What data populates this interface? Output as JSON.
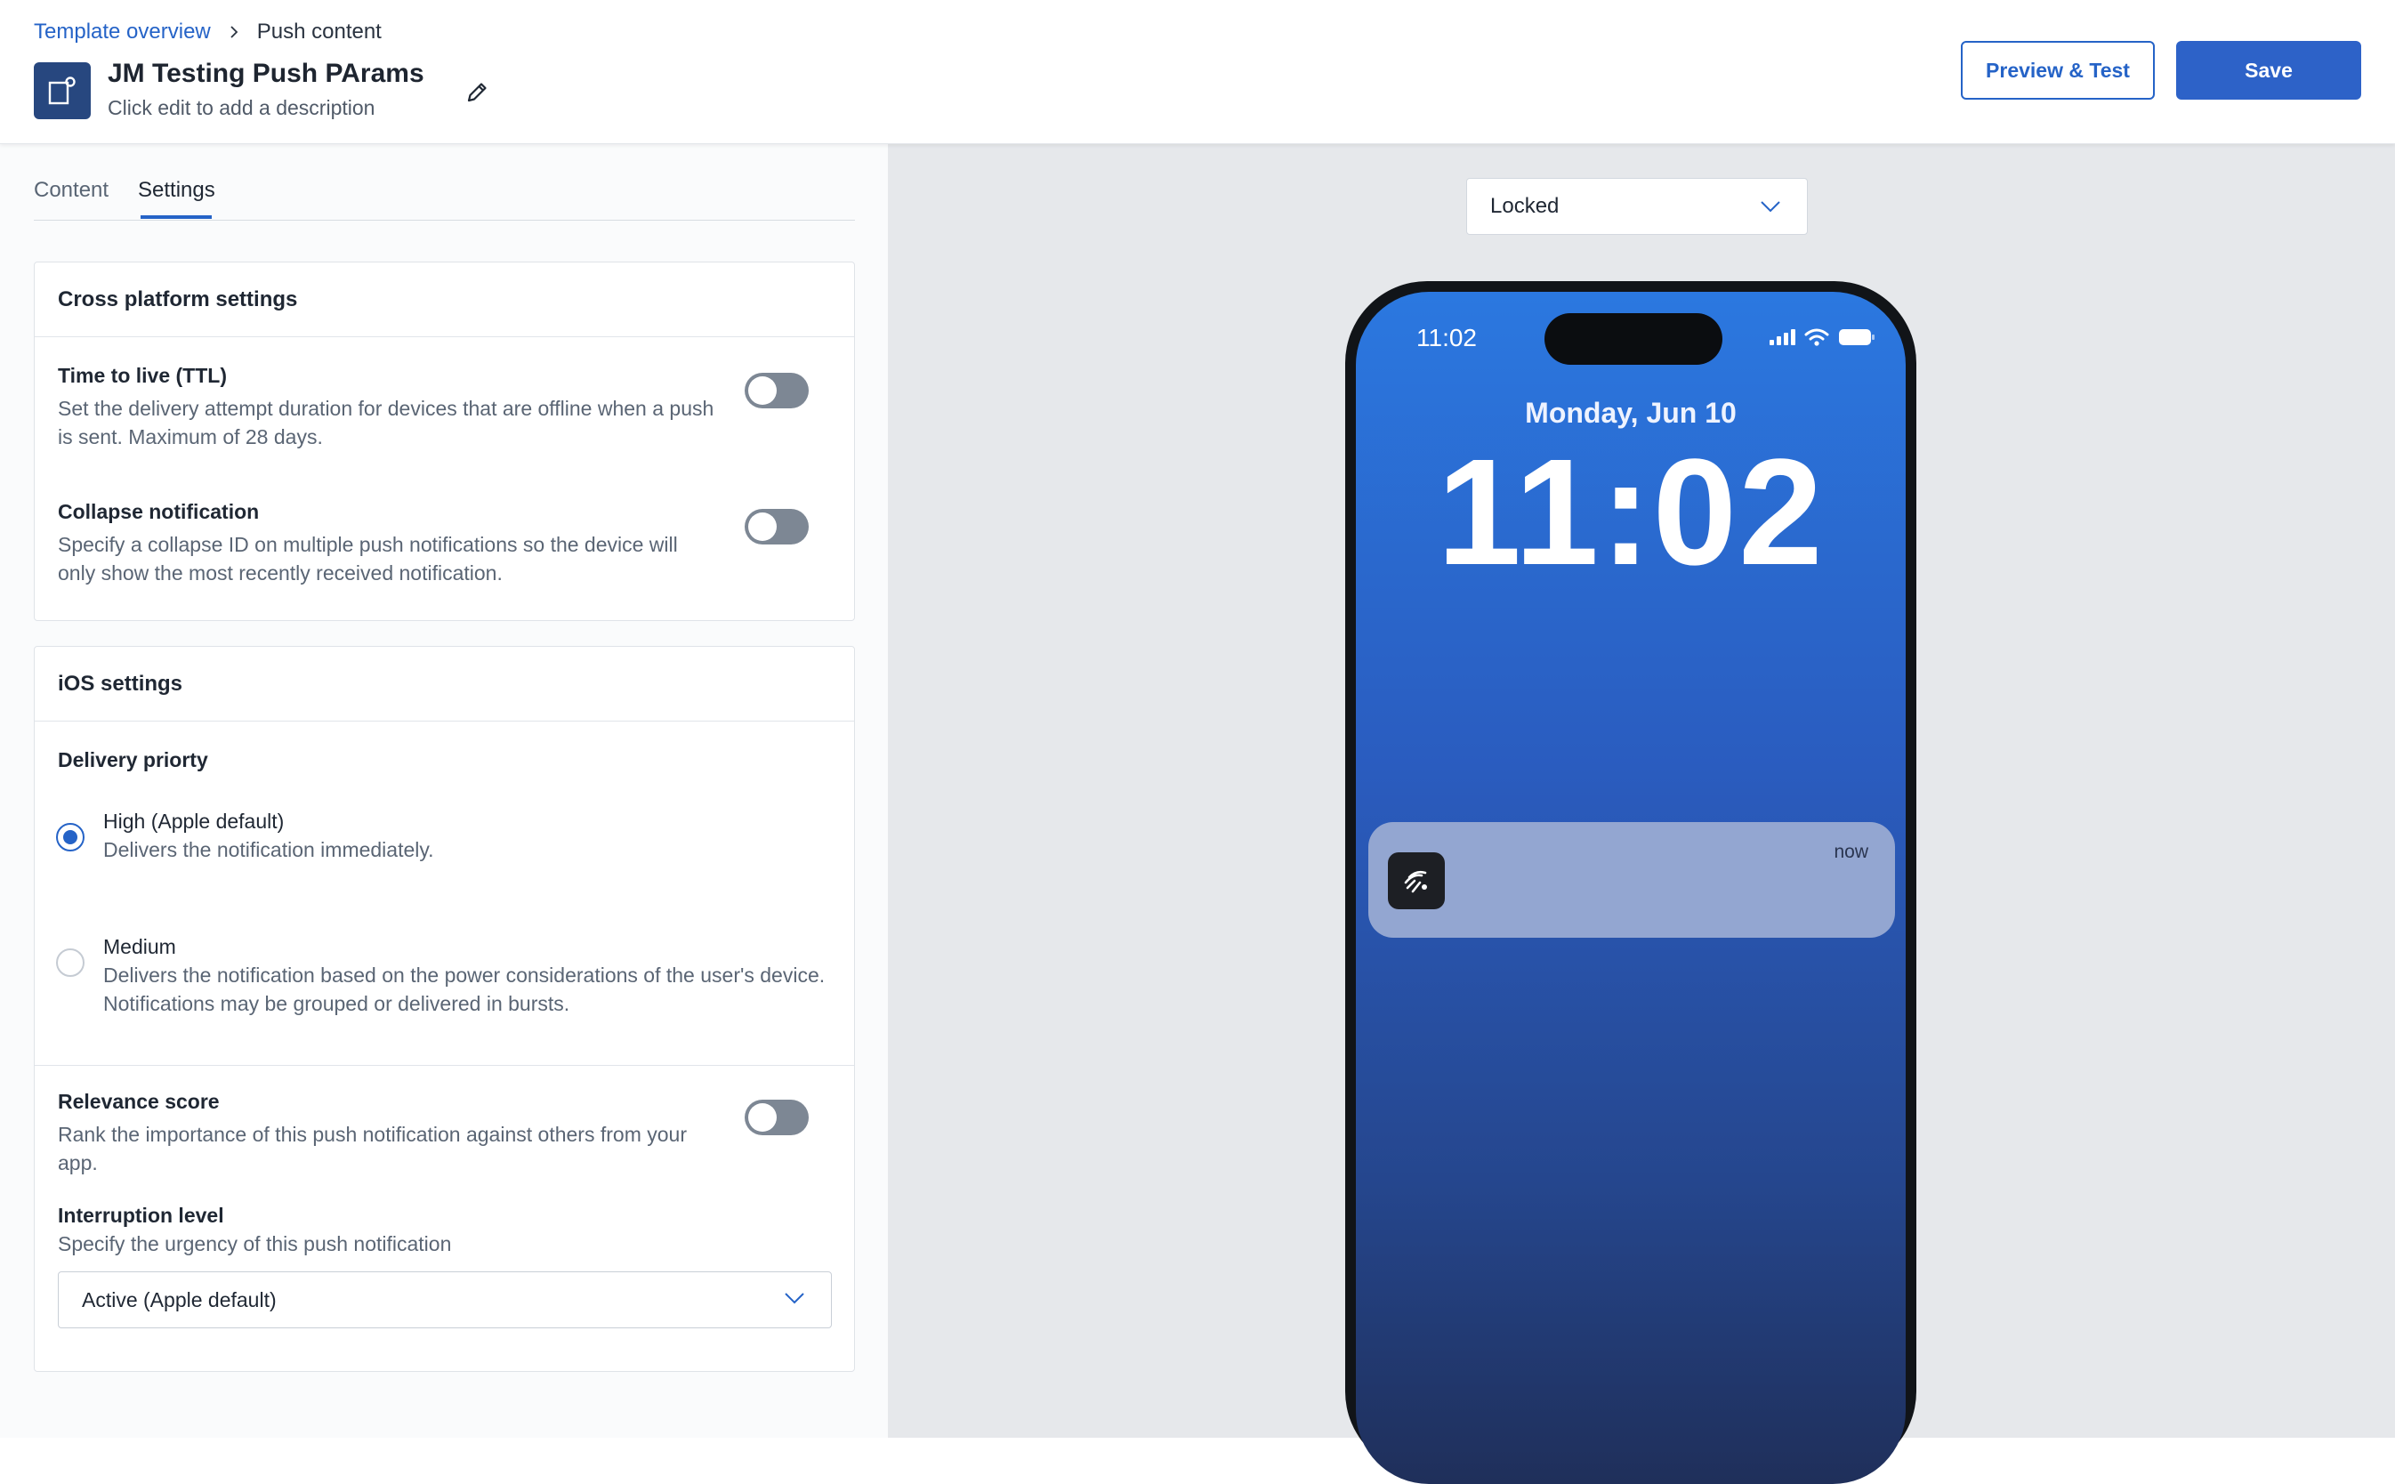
{
  "breadcrumb": {
    "parent": "Template overview",
    "current": "Push content"
  },
  "header": {
    "title": "JM Testing Push PArams",
    "subtitle": "Click edit to add a description",
    "preview_button": "Preview & Test",
    "save_button": "Save"
  },
  "tabs": [
    {
      "label": "Content",
      "active": false
    },
    {
      "label": "Settings",
      "active": true
    }
  ],
  "cross_platform": {
    "heading": "Cross platform settings",
    "ttl": {
      "title": "Time to live (TTL)",
      "desc": "Set the delivery attempt duration for devices that are offline when a push is sent. Maximum of 28 days.",
      "enabled": false
    },
    "collapse": {
      "title": "Collapse notification",
      "desc": "Specify a collapse ID on multiple push notifications so the device will only show the most recently received notification.",
      "enabled": false
    }
  },
  "ios": {
    "heading": "iOS settings",
    "delivery_title": "Delivery priorty",
    "options": [
      {
        "label": "High (Apple default)",
        "desc": "Delivers the notification immediately.",
        "selected": true
      },
      {
        "label": "Medium",
        "desc": "Delivers the notification based on the power considerations of the user's device. Notifications may be grouped or delivered in bursts.",
        "selected": false
      }
    ],
    "relevance": {
      "title": "Relevance score",
      "desc": "Rank the importance of this push notification against others from your app.",
      "enabled": false
    },
    "interruption": {
      "title": "Interruption level",
      "desc": "Specify the urgency of this push notification",
      "value": "Active (Apple default)"
    }
  },
  "preview": {
    "state_select": "Locked",
    "status_time": "11:02",
    "date": "Monday, Jun 10",
    "clock": "11:02",
    "notification_time": "now"
  },
  "colors": {
    "accent": "#2563c7",
    "brand_icon": "#27477f",
    "toggle_off": "#7d8794"
  }
}
